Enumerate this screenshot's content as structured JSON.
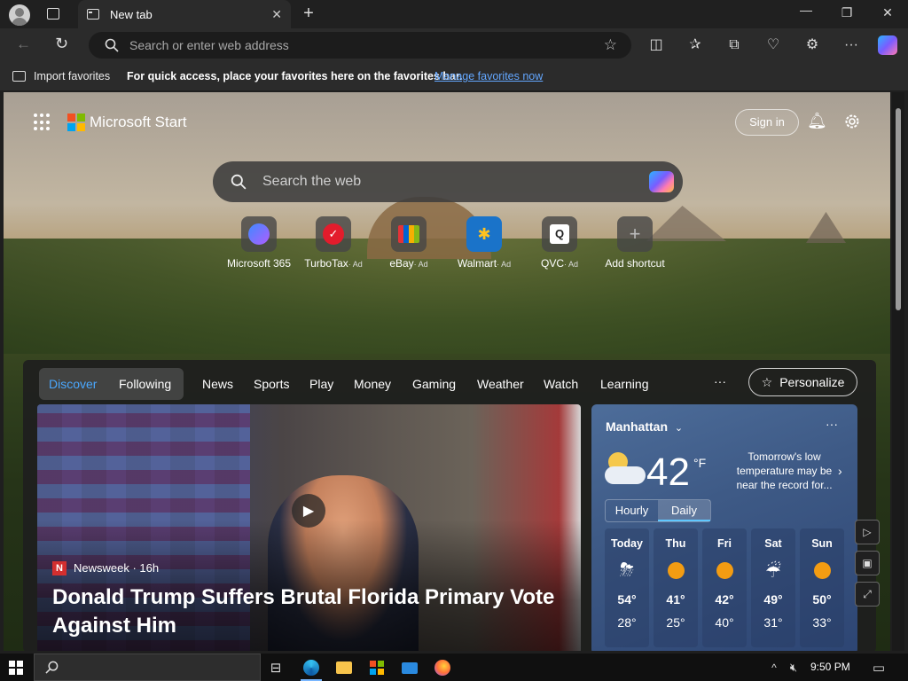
{
  "browser": {
    "tab_title": "New tab",
    "address_placeholder": "Search or enter web address"
  },
  "favorites_bar": {
    "import_label": "Import favorites",
    "message": "For quick access, place your favorites here on the favorites bar.",
    "manage_link": "Manage favorites now"
  },
  "header": {
    "brand": "Microsoft Start",
    "signin": "Sign in"
  },
  "search": {
    "placeholder": "Search the web"
  },
  "shortcuts": [
    {
      "label": "Microsoft 365",
      "ad": ""
    },
    {
      "label": "TurboTax",
      "ad": "· Ad"
    },
    {
      "label": "eBay",
      "ad": "· Ad"
    },
    {
      "label": "Walmart",
      "ad": "· Ad"
    },
    {
      "label": "QVC",
      "ad": "· Ad"
    },
    {
      "label": "Add shortcut",
      "ad": ""
    }
  ],
  "feed_tabs": [
    "Discover",
    "Following",
    "News",
    "Sports",
    "Play",
    "Money",
    "Gaming",
    "Weather",
    "Watch",
    "Learning"
  ],
  "personalize": "Personalize",
  "news": {
    "source": "Newsweek · 16h",
    "source_badge": "N",
    "headline": "Donald Trump Suffers Brutal Florida Primary Vote Against Him"
  },
  "weather": {
    "city": "Manhattan",
    "temp": "42",
    "unit": "°F",
    "note": "Tomorrow's low temperature may be near the record for...",
    "tab_hourly": "Hourly",
    "tab_daily": "Daily",
    "days": [
      {
        "name": "Today",
        "hi": "54°",
        "lo": "28°"
      },
      {
        "name": "Thu",
        "hi": "41°",
        "lo": "25°"
      },
      {
        "name": "Fri",
        "hi": "42°",
        "lo": "40°"
      },
      {
        "name": "Sat",
        "hi": "49°",
        "lo": "31°"
      },
      {
        "name": "Sun",
        "hi": "50°",
        "lo": "33°"
      }
    ]
  },
  "taskbar": {
    "time": "9:50 PM"
  },
  "colors": {
    "accent_link": "#63a7ff",
    "discover_blue": "#4aa8ff",
    "weather_tab": "#5fc8ff"
  }
}
